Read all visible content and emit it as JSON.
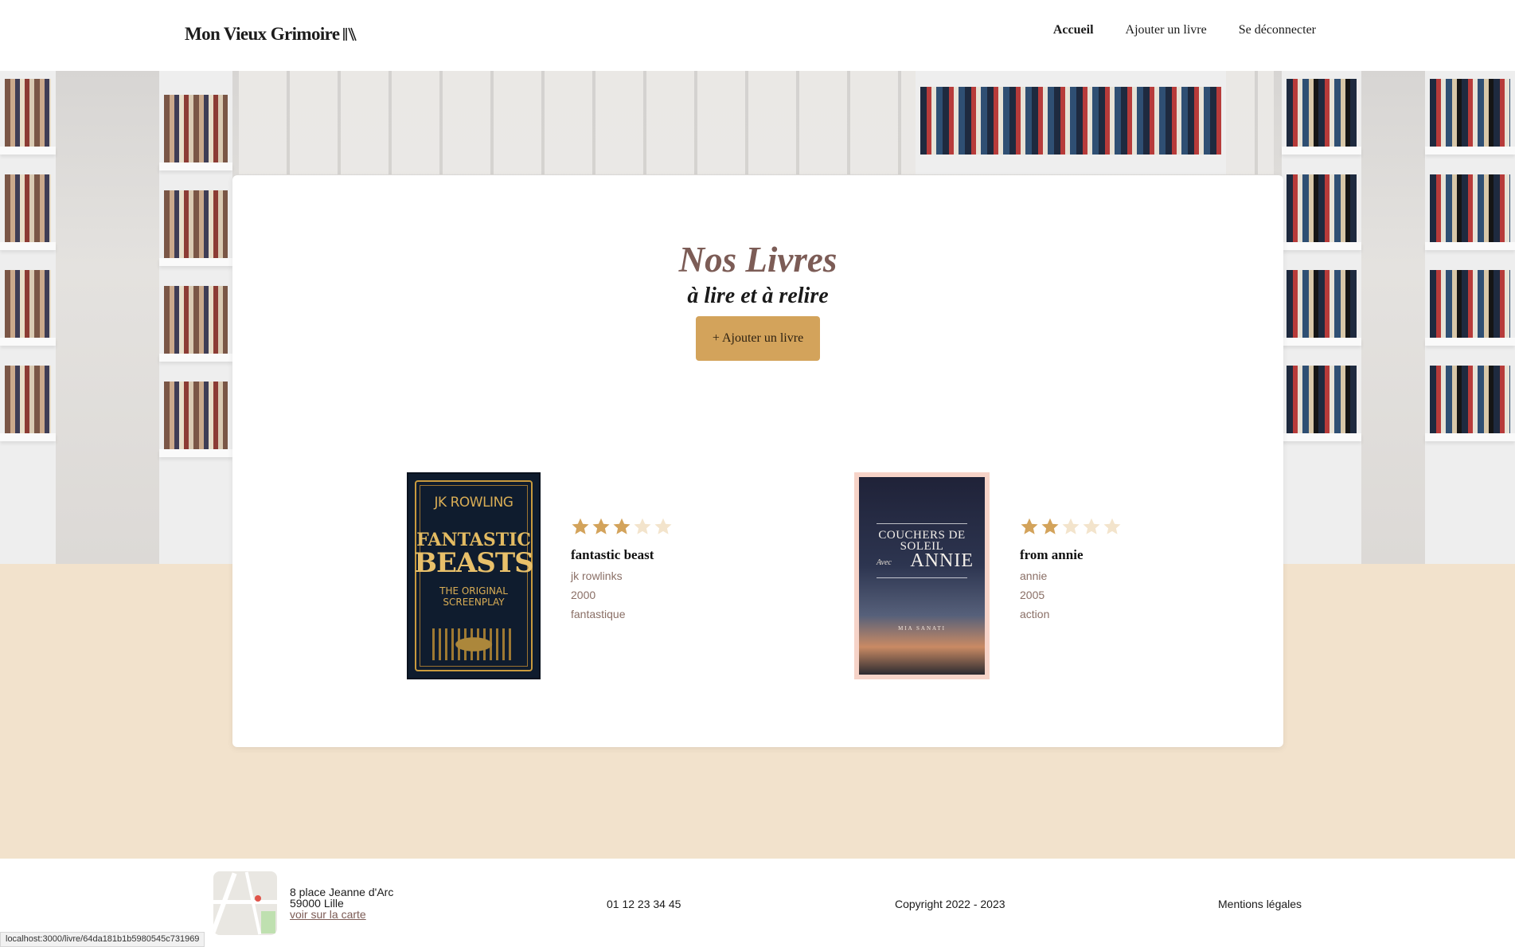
{
  "header": {
    "logo_text": "Mon Vieux Grimoire",
    "nav": [
      {
        "label": "Accueil",
        "active": true
      },
      {
        "label": "Ajouter un livre",
        "active": false
      },
      {
        "label": "Se déconnecter",
        "active": false
      }
    ]
  },
  "main": {
    "title": "Nos Livres",
    "subtitle": "à lire et à relire",
    "add_button_label": "+ Ajouter un livre",
    "books": [
      {
        "title": "fantastic beast",
        "author": "jk rowlinks",
        "year": "2000",
        "genre": "fantastique",
        "rating": 3,
        "cover_text": {
          "author": "JK ROWLING",
          "line1": "FANTASTIC",
          "line2": "BEASTS",
          "line3": "THE ORIGINAL SCREENPLAY"
        }
      },
      {
        "title": "from annie",
        "author": "annie",
        "year": "2005",
        "genre": "action",
        "rating": 2,
        "cover_text": {
          "line1": "COUCHERS DE SOLEIL",
          "line2": "ANNIE",
          "small": "Avec",
          "author": "MIA SANATI"
        }
      }
    ]
  },
  "footer": {
    "address_line1": "8 place Jeanne d'Arc",
    "address_line2": "59000 Lille",
    "map_link": "voir sur la carte",
    "phone": "01 12 23 34 45",
    "copyright": "Copyright 2022 - 2023",
    "legal": "Mentions légales"
  },
  "status_url": "localhost:3000/livre/64da181b1b5980545c731969",
  "colors": {
    "accent": "#d3a35b",
    "title": "#7c5c56",
    "band": "#f2e2cc",
    "star_filled": "#d3a35b",
    "star_empty": "#f3e4cc"
  }
}
